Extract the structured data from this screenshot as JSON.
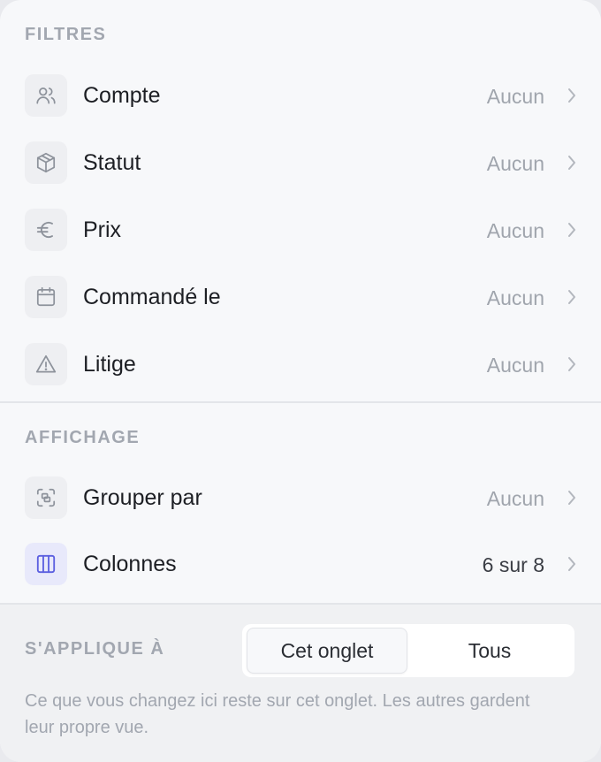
{
  "filters": {
    "title": "FILTRES",
    "items": [
      {
        "label": "Compte",
        "value": "Aucun",
        "icon": "users-icon"
      },
      {
        "label": "Statut",
        "value": "Aucun",
        "icon": "box-icon"
      },
      {
        "label": "Prix",
        "value": "Aucun",
        "icon": "euro-icon"
      },
      {
        "label": "Commandé le",
        "value": "Aucun",
        "icon": "calendar-icon"
      },
      {
        "label": "Litige",
        "value": "Aucun",
        "icon": "warning-icon"
      }
    ]
  },
  "display": {
    "title": "AFFICHAGE",
    "items": [
      {
        "label": "Grouper par",
        "value": "Aucun",
        "icon": "group-icon"
      },
      {
        "label": "Colonnes",
        "value": "6 sur 8",
        "icon": "columns-icon"
      }
    ]
  },
  "scope": {
    "title": "S'APPLIQUE À",
    "options": [
      "Cet onglet",
      "Tous"
    ],
    "selected": "Cet onglet",
    "note": "Ce que vous changez ici reste sur cet onglet. Les autres gardent leur propre vue."
  },
  "colors": {
    "accent": "#5b5fe0",
    "icon_gray": "#8d929b"
  }
}
